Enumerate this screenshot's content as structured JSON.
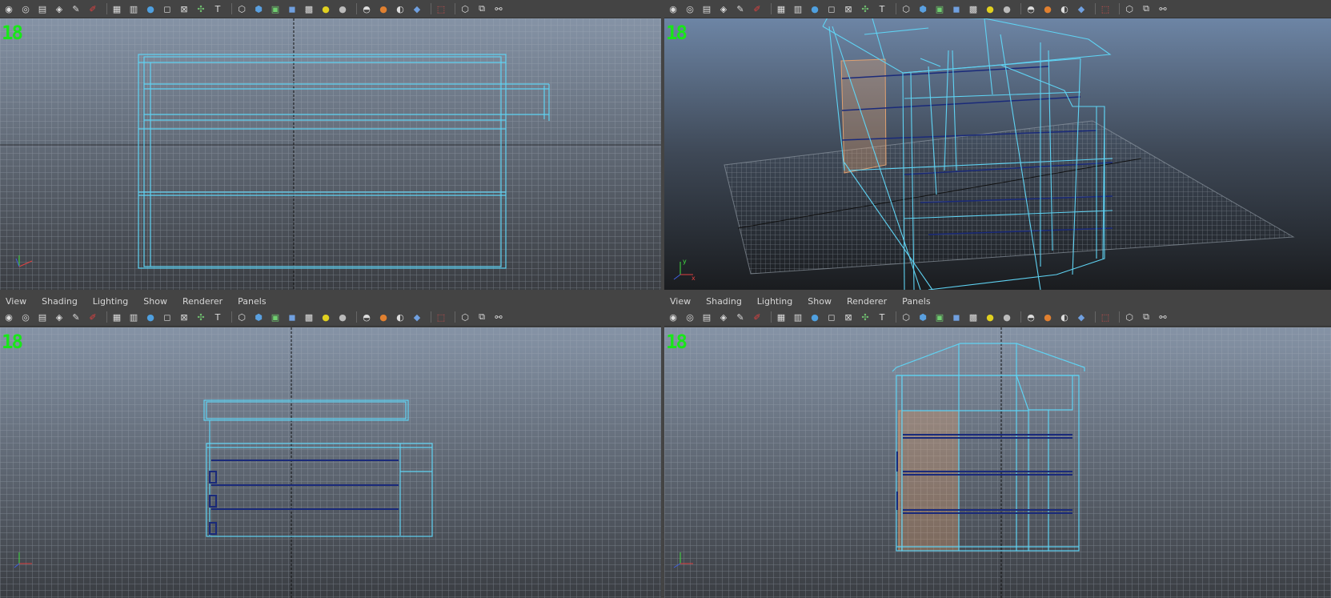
{
  "menus": [
    "View",
    "Shading",
    "Lighting",
    "Show",
    "Renderer",
    "Panels"
  ],
  "toolbar_icons": [
    "select-camera-icon",
    "camera-attributes-icon",
    "bookmark-icon",
    "image-plane-icon",
    "grease-pencil-icon",
    "2d-pan-zoom-icon",
    "grid-icon",
    "film-gate-icon",
    "resolution-gate-icon",
    "gate-mask-icon",
    "field-chart-icon",
    "safe-action-icon",
    "safe-title-icon",
    "wireframe-icon",
    "smooth-shade-icon",
    "wireframe-on-shaded-icon",
    "xray-icon",
    "textured-icon",
    "use-all-lights-icon",
    "shadows-icon",
    "screen-space-ao-icon",
    "motion-blur-icon",
    "multisample-aa-icon",
    "depth-of-field-icon",
    "isolate-select-icon",
    "xray-joints-icon",
    "xray-active-icon",
    "grease-pencil-2-icon"
  ],
  "hud_label": "18",
  "axis": {
    "x": "x",
    "y": "y",
    "z": "z"
  },
  "colors": {
    "panel_bg": "#444444",
    "viewport_top": "#8593a6",
    "viewport_bottom": "#3a3d42",
    "persp_top": "#6d85a5",
    "persp_bottom": "#1a1c1f",
    "grid_line": "#9aa3ad",
    "wire": "#5fd3f3",
    "wire_dark": "#1a2a7a",
    "selected_face": "#e0a070",
    "hud_green": "#19e619"
  }
}
